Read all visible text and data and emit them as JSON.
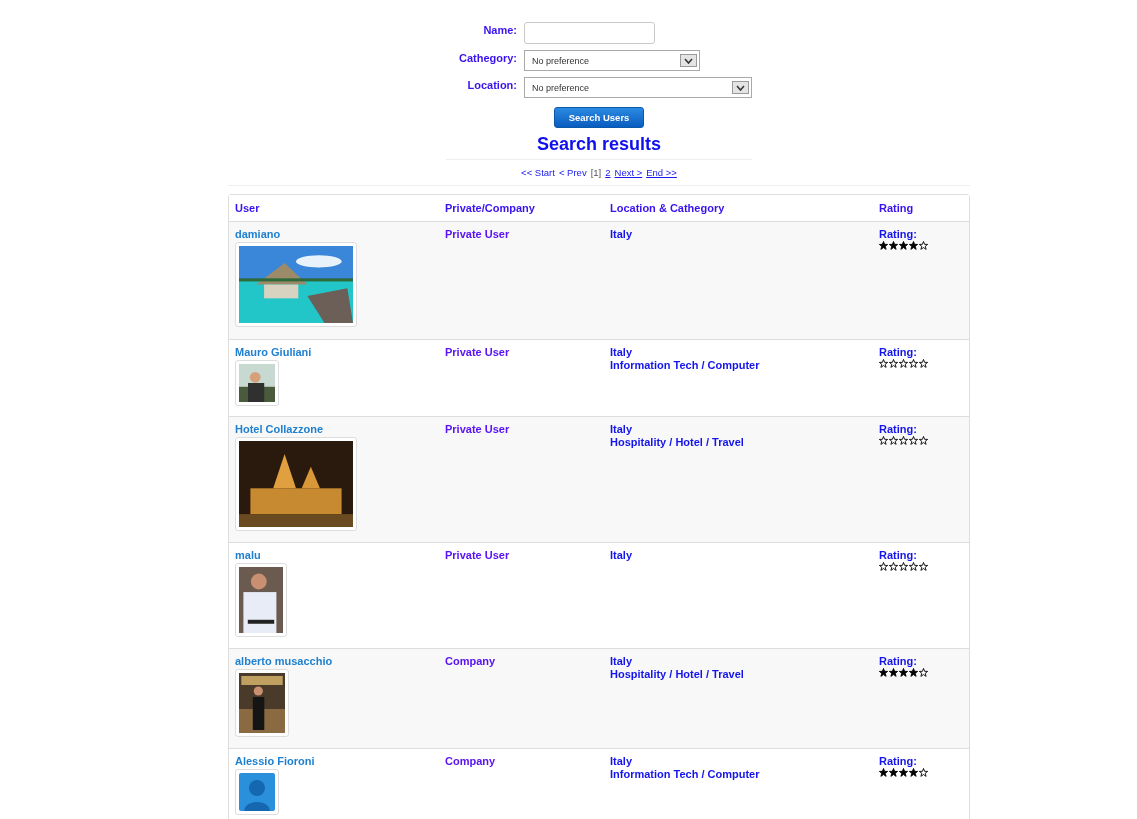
{
  "search_form": {
    "fields": [
      {
        "kind": "text",
        "label": "Name:"
      },
      {
        "kind": "select",
        "label": "Cathegory:",
        "value": "No preference"
      },
      {
        "kind": "select",
        "label": "Location:",
        "value": "No preference"
      }
    ],
    "button": "Search Users"
  },
  "results_title": "Search results",
  "pagination": [
    {
      "label": "<< Start",
      "link": false,
      "selected": false
    },
    {
      "label": "< Prev",
      "link": false,
      "selected": false
    },
    {
      "label": "[1]",
      "link": false,
      "selected": true
    },
    {
      "label": "2",
      "link": true,
      "selected": false
    },
    {
      "label": "Next >",
      "link": true,
      "selected": false
    },
    {
      "label": "End >>",
      "link": true,
      "selected": false
    }
  ],
  "table": {
    "columns": [
      "User",
      "Private/Company",
      "Location & Cathegory",
      "Rating"
    ],
    "rows": [
      {
        "user": "damiano",
        "type": "Private User",
        "location": "Italy",
        "rating_label": "Rating:",
        "stars": 4
      },
      {
        "user": "Mauro Giuliani",
        "type": "Private User",
        "location": "Italy",
        "category": "Information Tech / Computer",
        "rating_label": "Rating:",
        "stars": 0
      },
      {
        "user": "Hotel Collazzone",
        "type": "Private User",
        "location": "Italy",
        "category": "Hospitality / Hotel / Travel",
        "rating_label": "Rating:",
        "stars": 0
      },
      {
        "user": "malu",
        "type": "Private User",
        "location": "Italy",
        "rating_label": "Rating:",
        "stars": 0
      },
      {
        "user": "alberto musacchio",
        "type": "Company",
        "location": "Italy",
        "category": "Hospitality / Hotel / Travel",
        "rating_label": "Rating:",
        "stars": 4
      },
      {
        "user": "Alessio Fioroni",
        "photo": {
          "kind": "silhouette"
        },
        "type": "Company",
        "location": "Italy",
        "category": "Information Tech / Computer",
        "rating_label": "Rating:",
        "stars": 4
      }
    ]
  }
}
